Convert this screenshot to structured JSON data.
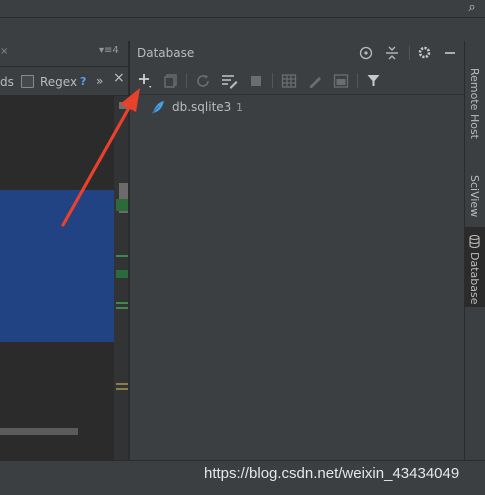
{
  "search_bar": {
    "partial_words_label": "ds",
    "regex_label": "Regex",
    "help_symbol": "?",
    "more_symbol": "»",
    "close_symbol": "×"
  },
  "database_panel": {
    "title": "Database",
    "tree": [
      {
        "name": "db.sqlite3",
        "count": "1"
      }
    ]
  },
  "right_tool_tabs": [
    {
      "label": "Remote Host"
    },
    {
      "label": "SciView"
    },
    {
      "label": "Database"
    }
  ],
  "watermark": "https://blog.csdn.net/weixin_43434049",
  "colors": {
    "accent_blue": "#589df6",
    "selection": "#214283",
    "annotation_arrow": "#e8412c"
  }
}
